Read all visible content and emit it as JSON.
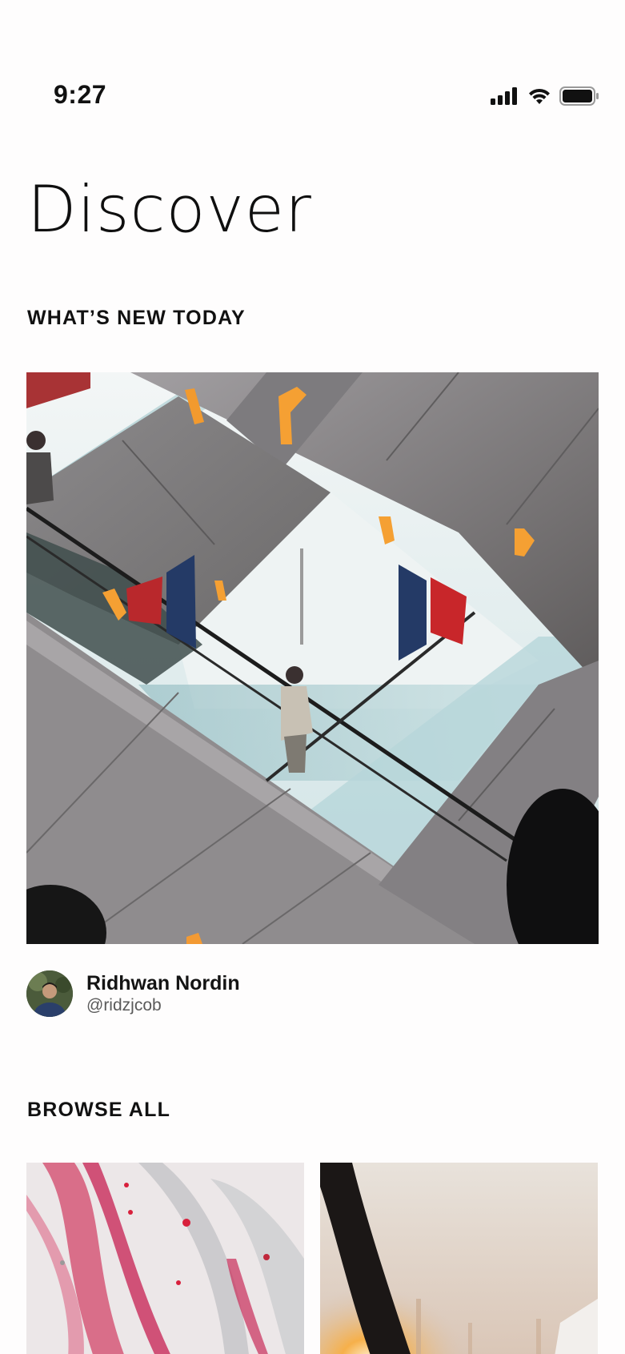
{
  "status_bar": {
    "time": "9:27",
    "icons": [
      "signal-icon",
      "wifi-icon",
      "battery-icon"
    ]
  },
  "page": {
    "title": "Discover"
  },
  "sections": {
    "whats_new": "WHAT’S NEW TODAY",
    "browse_all": "BROWSE ALL"
  },
  "featured": {
    "image_subject": "escalators photo",
    "author": {
      "name": "Ridhwan Nordin",
      "handle": "@ridzjcob"
    }
  },
  "browse": {
    "items": [
      {
        "subject": "pink and grey marble fluid art"
      },
      {
        "subject": "hand raised against sunset"
      }
    ]
  },
  "colors": {
    "background": "#fefdfd",
    "text": "#0d0d0d",
    "secondary_text": "#5a5a5a"
  }
}
